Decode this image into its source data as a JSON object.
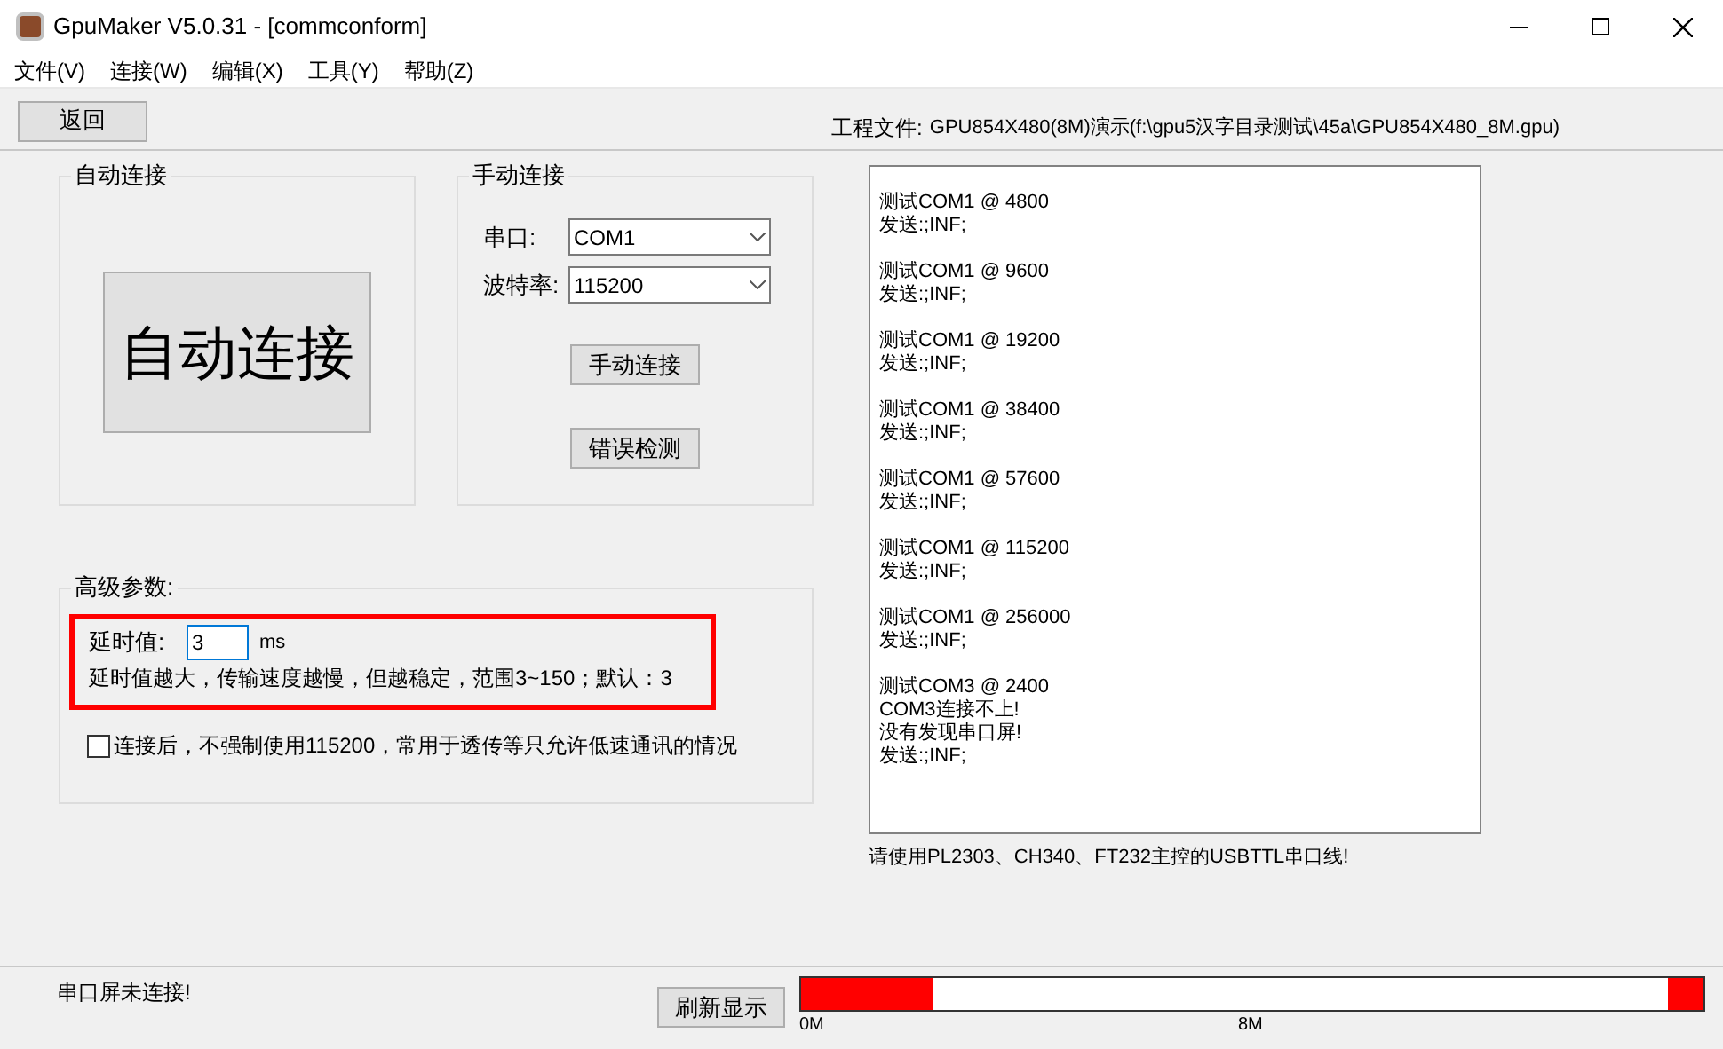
{
  "window": {
    "title": "GpuMaker V5.0.31 - [commconform]"
  },
  "menu": [
    "文件(V)",
    "连接(W)",
    "编辑(X)",
    "工具(Y)",
    "帮助(Z)"
  ],
  "toolbar": {
    "back_button": "返回",
    "project_label": "工程文件:",
    "project_path": "GPU854X480(8M)演示(f:\\gpu5汉字目录测试\\45a\\GPU854X480_8M.gpu)"
  },
  "auto_connect": {
    "title": "自动连接",
    "button": "自动连接"
  },
  "manual_connect": {
    "title": "手动连接",
    "port_label": "串口:",
    "port_value": "COM1",
    "baud_label": "波特率:",
    "baud_value": "115200",
    "connect_button": "手动连接",
    "check_button": "错误检测"
  },
  "advanced": {
    "title": "高级参数:",
    "delay_label": "延时值:",
    "delay_value": "3",
    "delay_unit": "ms",
    "delay_hint": "延时值越大，传输速度越慢，但越稳定，范围3~150；默认：3",
    "force_checkbox": {
      "label": "连接后，不强制使用115200，常用于透传等只允许低速通讯的情况",
      "checked": false
    }
  },
  "log": [
    [
      "测试COM1 @ 4800",
      "发送:;INF;"
    ],
    [
      "测试COM1 @ 9600",
      "发送:;INF;"
    ],
    [
      "测试COM1 @ 19200",
      "发送:;INF;"
    ],
    [
      "测试COM1 @ 38400",
      "发送:;INF;"
    ],
    [
      "测试COM1 @ 57600",
      "发送:;INF;"
    ],
    [
      "测试COM1 @ 115200",
      "发送:;INF;"
    ],
    [
      "测试COM1 @ 256000",
      "发送:;INF;"
    ],
    [
      "测试COM3 @ 2400",
      "COM3连接不上!",
      "没有发现串口屏!",
      "发送:;INF;"
    ]
  ],
  "log_hint": "请使用PL2303、CH340、FT232主控的USBTTL串口线!",
  "status_bar": {
    "status": "串口屏未连接!",
    "refresh_button": "刷新显示",
    "memory_bar": {
      "start": {
        "level": 0.145
      },
      "end": {
        "level": 0.04
      },
      "ticks": [
        "0M",
        "8M"
      ]
    }
  }
}
